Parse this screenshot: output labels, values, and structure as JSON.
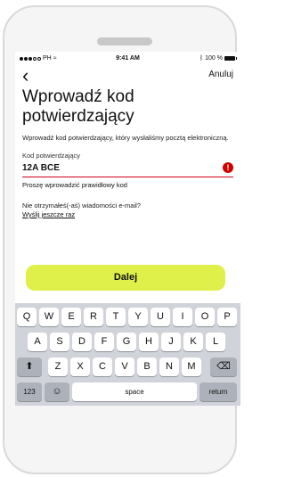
{
  "status": {
    "carrier": "PH",
    "time": "9:41 AM",
    "battery": "100 %"
  },
  "nav": {
    "back_icon": "‹",
    "cancel_label": "Anuluj"
  },
  "title": "Wprowadź kod potwierdzający",
  "description": "Wprowadź kod potwierdzający, który wysłaliśmy pocztą elektroniczną.",
  "code_field": {
    "label": "Kod potwierdzający",
    "value": "12A BCE",
    "error_icon": "!",
    "error_message": "Proszę wprowadzić prawidłowy kod",
    "error_color": "#cc0000"
  },
  "resend": {
    "question": "Nie otrzymałeś(-aś) wiadomości e-mail?",
    "link": "Wyślij jeszcze raz"
  },
  "primary_button": {
    "label": "Dalej",
    "color": "#dff04a"
  },
  "keyboard": {
    "row1": [
      "Q",
      "W",
      "E",
      "R",
      "T",
      "Y",
      "U",
      "I",
      "O",
      "P"
    ],
    "row2": [
      "A",
      "S",
      "D",
      "F",
      "G",
      "H",
      "J",
      "K",
      "L"
    ],
    "row3": [
      "Z",
      "X",
      "C",
      "V",
      "B",
      "N",
      "M"
    ],
    "shift": "⬆",
    "backspace": "⌫",
    "numbers": "123",
    "emoji": "☺",
    "space": "space",
    "return": "return"
  }
}
